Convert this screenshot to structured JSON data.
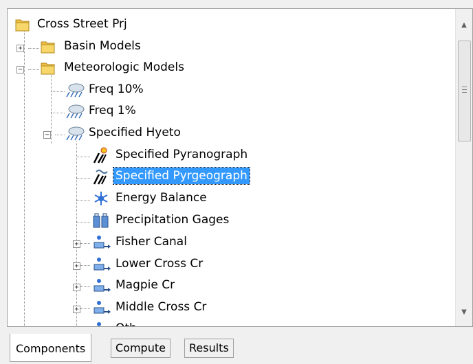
{
  "tree": {
    "items": [
      {
        "label": "Cross Street Prj",
        "icon": "folder-icon",
        "expander": ""
      },
      {
        "label": "Basin Models",
        "icon": "folder-icon",
        "expander": "+"
      },
      {
        "label": "Meteorologic Models",
        "icon": "folder-icon",
        "expander": "−"
      },
      {
        "label": "Freq 10%",
        "icon": "cloud-rain-icon",
        "expander": ""
      },
      {
        "label": "Freq 1%",
        "icon": "cloud-rain-icon",
        "expander": ""
      },
      {
        "label": "Specified Hyeto",
        "icon": "cloud-rain-icon",
        "expander": "−"
      },
      {
        "label": "Specified Pyranograph",
        "icon": "shortwave-radiation-icon",
        "expander": ""
      },
      {
        "label": "Specified Pyrgeograph",
        "icon": "longwave-radiation-icon",
        "expander": "",
        "selected": true
      },
      {
        "label": "Energy Balance",
        "icon": "snowflake-icon",
        "expander": ""
      },
      {
        "label": "Precipitation Gages",
        "icon": "precipitation-gages-icon",
        "expander": ""
      },
      {
        "label": "Fisher Canal",
        "icon": "subbasin-icon",
        "expander": "+"
      },
      {
        "label": "Lower Cross Cr",
        "icon": "subbasin-icon",
        "expander": "+"
      },
      {
        "label": "Magpie Cr",
        "icon": "subbasin-icon",
        "expander": "+"
      },
      {
        "label": "Middle Cross Cr",
        "icon": "subbasin-icon",
        "expander": "+"
      },
      {
        "label": "Oth...",
        "icon": "subbasin-icon",
        "expander": "+"
      }
    ]
  },
  "tabs": {
    "components": "Components",
    "compute": "Compute",
    "results": "Results",
    "active": "Components"
  },
  "scrollbar": {
    "up_glyph": "▲",
    "down_glyph": "▼"
  },
  "colors": {
    "selection": "#3399ff",
    "folder": "#f0c040"
  }
}
